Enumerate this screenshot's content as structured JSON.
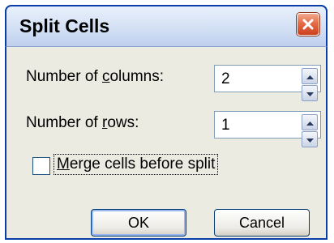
{
  "dialog": {
    "title": "Split Cells"
  },
  "columns": {
    "label_pre": "Number of ",
    "label_accel": "c",
    "label_post": "olumns:",
    "value": "2"
  },
  "rows": {
    "label_pre": "Number of ",
    "label_accel": "r",
    "label_post": "ows:",
    "value": "1"
  },
  "merge": {
    "label_accel": "M",
    "label_post": "erge cells before split",
    "checked": false
  },
  "buttons": {
    "ok": "OK",
    "cancel": "Cancel"
  },
  "icons": {
    "close": "close-icon",
    "spin_up": "spin-up-icon",
    "spin_down": "spin-down-icon"
  },
  "colors": {
    "close_button": "#e56c47",
    "window_border": "#0a3ea8",
    "dialog_bg": "#ecebe2"
  }
}
